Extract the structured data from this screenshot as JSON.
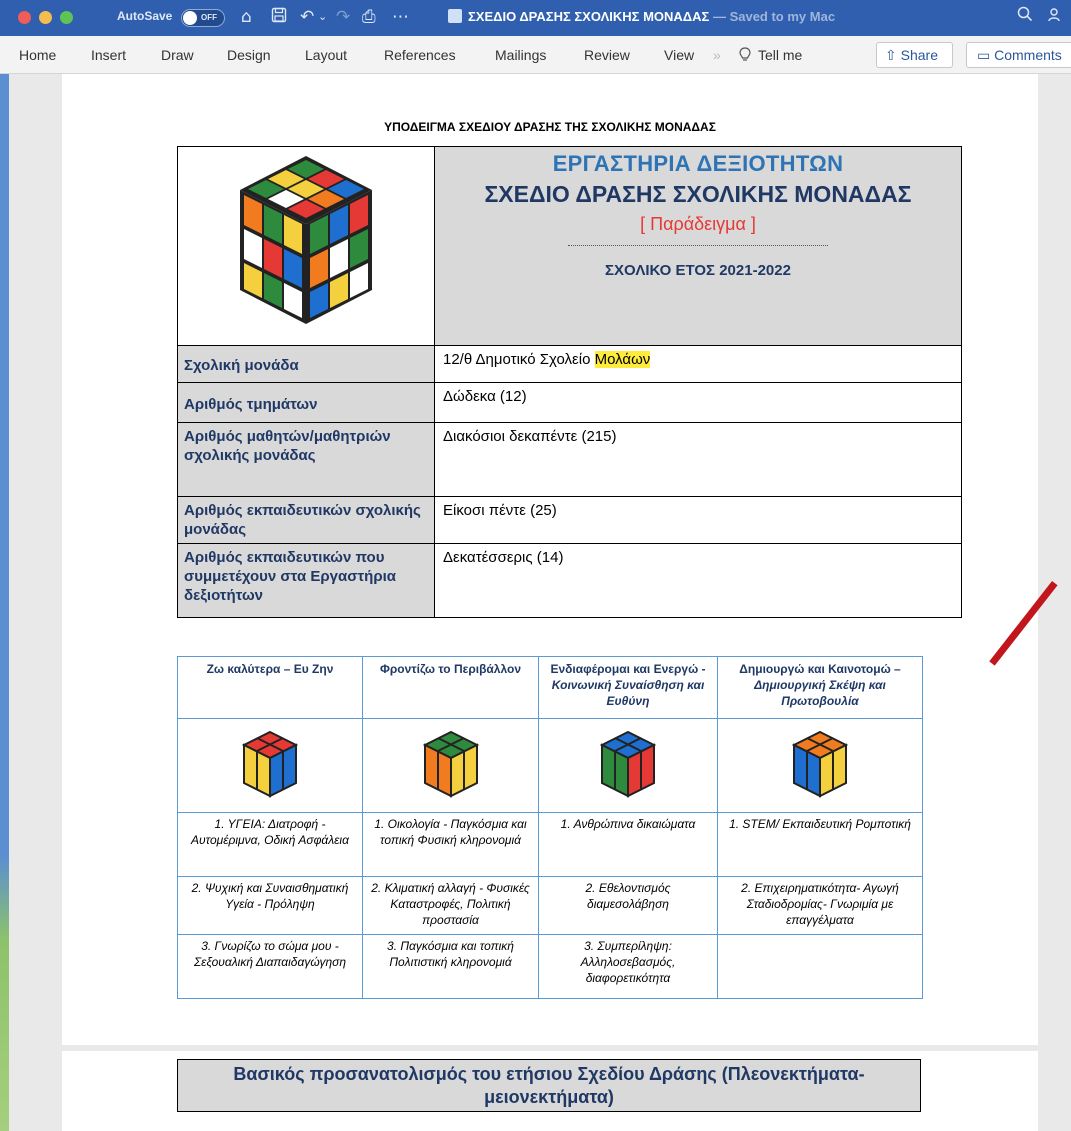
{
  "titlebar": {
    "autosave_label": "AutoSave",
    "autosave_state": "OFF",
    "doc_name": "ΣΧΕΔΙΟ ΔΡΑΣΗΣ ΣΧΟΛΙΚΗΣ ΜΟΝΑΔΑΣ",
    "saved_status": " — Saved to my Mac",
    "icons": [
      "home-icon",
      "save-icon",
      "undo-icon",
      "redo-icon",
      "print-icon",
      "more-icon",
      "search-icon",
      "share-people-icon"
    ]
  },
  "ribbon": {
    "tabs": [
      "Home",
      "Insert",
      "Draw",
      "Design",
      "Layout",
      "References",
      "Mailings",
      "Review",
      "View"
    ],
    "tell_me": "Tell me",
    "share": "Share",
    "comments": "Comments"
  },
  "document": {
    "heading": "ΥΠΟΔΕΙΓΜΑ ΣΧΕΔΙΟΥ ΔΡΑΣΗΣ ΤΗΣ ΣΧΟΛΙΚΗΣ ΜΟΝΑΔΑΣ",
    "header": {
      "line1": "ΕΡΓΑΣΤΗΡΙΑ ΔΕΞΙΟΤΗΤΩΝ",
      "line2": "ΣΧΕΔΙΟ ΔΡΑΣΗΣ ΣΧΟΛΙΚΗΣ ΜΟΝΑΔΑΣ",
      "line3": "[ Παράδειγμα ]",
      "line4": "ΣΧΟΛΙΚΟ ΕΤΟΣ 2021-2022"
    },
    "info": {
      "school_label": "Σχολική μονάδα",
      "school_value_prefix": "12/θ Δημοτικό Σχολείο ",
      "school_value_highlight": "Μολάων",
      "sections_label": "Αριθμός τμημάτων",
      "sections_value": "Δώδεκα (12)",
      "students_label": "Αριθμός μαθητών/μαθητριών σχολικής μονάδας",
      "students_value": "Διακόσιοι δεκαπέντε (215)",
      "teachers_label": "Αριθμός εκπαιδευτικών σχολικής μονάδας",
      "teachers_value": "Είκοσι πέντε (25)",
      "participants_label": "Αριθμός εκπαιδευτικών που συμμετέχουν στα Εργαστήρια δεξιοτήτων",
      "participants_value": "Δεκατέσσερις (14)"
    },
    "themes": {
      "h1": "Ζω καλύτερα – Ευ Ζην",
      "h2": "Φροντίζω το Περιβάλλον",
      "h3_main": "Ενδιαφέρομαι και Ενεργώ",
      "h3_sub": "Κοινωνική Συναίσθηση και Ευθύνη",
      "h4_main": "Δημιουργώ και Καινοτομώ",
      "h4_sub": "Δημιουργική Σκέψη και Πρωτοβουλία",
      "c1r1": "1. ΥΓΕΙΑ: Διατροφή - Αυτομέριμνα, Οδική Ασφάλεια",
      "c2r1": "1. Οικολογία - Παγκόσμια και τοπική Φυσική κληρονομιά",
      "c3r1": "1. Ανθρώπινα δικαιώματα",
      "c4r1": "1. STEM/ Εκπαιδευτική Ρομποτική",
      "c1r2": "2. Ψυχική και Συναισθηματική Υγεία - Πρόληψη",
      "c2r2": "2. Κλιματική αλλαγή - Φυσικές Καταστροφές, Πολιτική προστασία",
      "c3r2": "2. Εθελοντισμός διαμεσολάβηση",
      "c4r2": "2. Επιχειρηματικότητα- Αγωγή Σταδιοδρομίας- Γνωριμία με επαγγέλματα",
      "c1r3": "3. Γνωρίζω το σώμα μου - Σεξουαλική Διαπαιδαγώγηση",
      "c2r3": "3. Παγκόσμια και τοπική Πολιτιστική κληρονομιά",
      "c3r3": "3. Συμπερίληψη: Αλληλοσεβασμός, διαφορετικότητα",
      "c4r3": ""
    },
    "orientation": "Βασικός προσανατολισμός του ετήσιου Σχεδίου Δράσης (Πλεονεκτήματα-μειονεκτήματα)"
  },
  "colors": {
    "titlebar": "#2f5fae",
    "heading_blue": "#1f3864",
    "accent_blue": "#2e74b5",
    "example_red": "#e53935",
    "highlight": "#ffeb3b",
    "cell_gray": "#d9d9d9",
    "table_border": "#5b9bd5"
  }
}
